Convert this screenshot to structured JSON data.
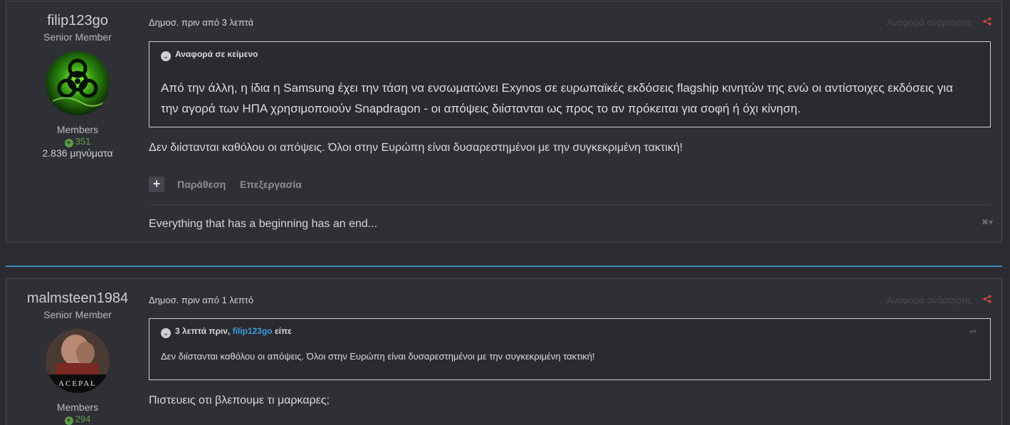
{
  "posts": [
    {
      "author": "filip123go",
      "title": "Senior Member",
      "group": "Members",
      "reputation": "351",
      "post_count": "2.836 μηνύματα",
      "date": "Δημοσ. πριν από 3 λεπτά",
      "report": "Αναφορά ανάρτησης",
      "quote_header": "Αναφορά σε κείμενο",
      "quote_text": " Από την άλλη, η ίδια η Samsung έχει την τάση να ενσωματώνει Exynos σε ευρωπαϊκές εκδόσεις flagship κινητών της ενώ οι αντίστοιχες εκδόσεις για την αγορά των ΗΠΑ χρησιμοποιούν Snapdragon - οι απόψεις διίστανται ως προς το αν πρόκειται για σοφή ή όχι κίνηση.",
      "body": "Δεν διίστανται καθόλου οι απόψεις. Όλοι στην Ευρώπη είναι δυσαρεστημένοι με την συγκεκριμένη τακτική!",
      "quote_action": "Παράθεση",
      "edit_action": "Επεξεργασία",
      "signature": "Everything that has a beginning has an end...",
      "avatar_icon": "biohazard-avatar"
    },
    {
      "author": "malmsteen1984",
      "title": "Senior Member",
      "group": "Members",
      "reputation": "294",
      "date": "Δημοσ. πριν από 1 λεπτό",
      "report": "Αναφορά ανάρτησης",
      "quote_header_prefix": "3 λεπτά πριν,",
      "quote_header_user": "filip123go",
      "quote_header_suffix": "είπε",
      "quote_text": "Δεν διίστανται καθόλου οι απόψεις. Όλοι στην Ευρώπη είναι δυσαρεστημένοι με την συγκεκριμένη τακτική!",
      "body": "Πιστευεις οτι βλεπουμε τι μαρκαρες;",
      "avatar_caption": "ACEPAL",
      "avatar_icon": "facepalm-avatar"
    }
  ],
  "colors": {
    "background": "#2b2b31",
    "accent": "#3d8fbf",
    "reputation": "#5f9f48",
    "quote_user": "#3a9fd8"
  }
}
